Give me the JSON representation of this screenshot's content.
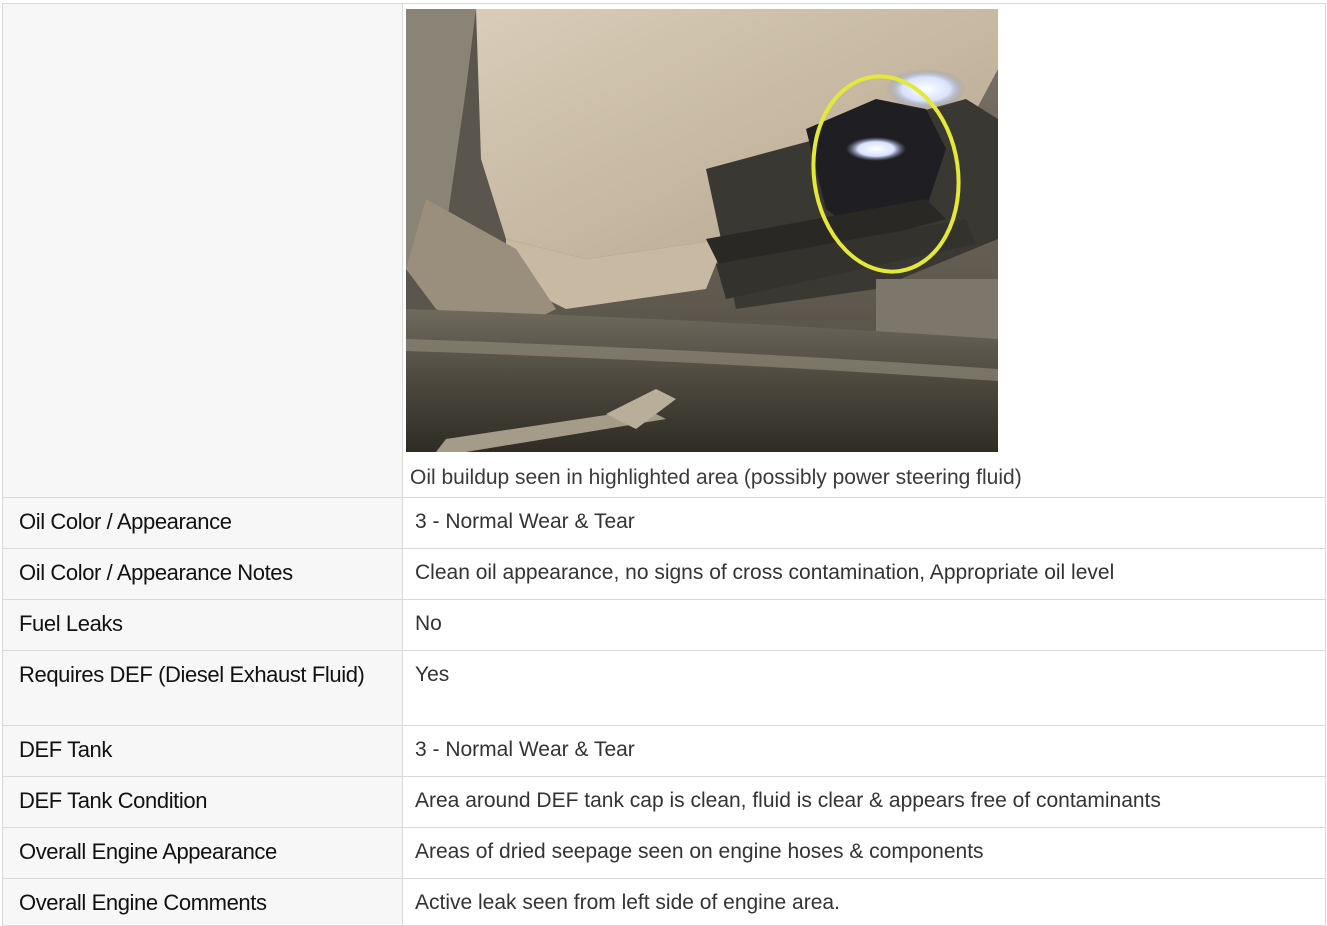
{
  "photo": {
    "alt": "engine-undercarriage-photo",
    "highlight_color": "#e4e83a",
    "caption": "Oil buildup seen in highlighted area (possibly power steering fluid)"
  },
  "rows": [
    {
      "label": "Oil Color / Appearance",
      "value": "3 - Normal Wear & Tear"
    },
    {
      "label": "Oil Color / Appearance Notes",
      "value": "Clean oil appearance, no signs of cross contamination, Appropriate oil level"
    },
    {
      "label": "Fuel Leaks",
      "value": "No"
    },
    {
      "label": "Requires DEF (Diesel Exhaust Fluid)",
      "value": "Yes"
    },
    {
      "label": "DEF Tank",
      "value": "3 - Normal Wear & Tear"
    },
    {
      "label": "DEF Tank Condition",
      "value": "Area around DEF tank cap is clean, fluid is clear & appears free of contaminants"
    },
    {
      "label": "Overall Engine Appearance",
      "value": "Areas of dried seepage seen on engine hoses & components"
    },
    {
      "label": "Overall Engine Comments",
      "value": "Active leak seen from left side of engine area."
    }
  ]
}
